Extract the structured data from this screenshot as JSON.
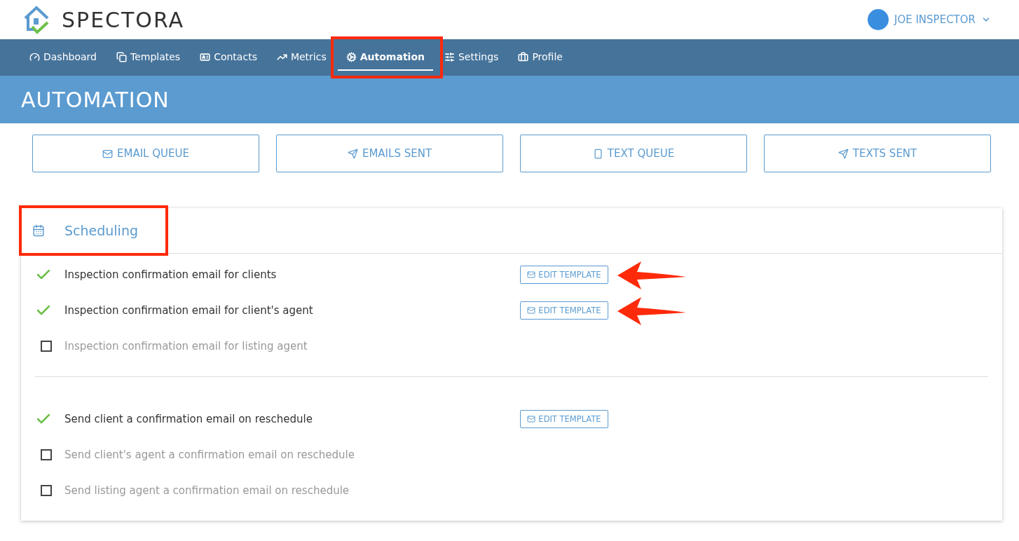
{
  "brand": {
    "name": "SPECTORA"
  },
  "user": {
    "name": "JOE INSPECTOR"
  },
  "nav": [
    {
      "label": "Dashboard",
      "selected": false,
      "highlighted": false
    },
    {
      "label": "Templates",
      "selected": false,
      "highlighted": false
    },
    {
      "label": "Contacts",
      "selected": false,
      "highlighted": false
    },
    {
      "label": "Metrics",
      "selected": false,
      "highlighted": false
    },
    {
      "label": "Automation",
      "selected": true,
      "highlighted": true
    },
    {
      "label": "Settings",
      "selected": false,
      "highlighted": false
    },
    {
      "label": "Profile",
      "selected": false,
      "highlighted": false
    }
  ],
  "page_title": "AUTOMATION",
  "actions": [
    {
      "label": "EMAIL QUEUE",
      "kind": "envelope"
    },
    {
      "label": "EMAILS SENT",
      "kind": "plane"
    },
    {
      "label": "TEXT QUEUE",
      "kind": "phone"
    },
    {
      "label": "TEXTS SENT",
      "kind": "plane"
    }
  ],
  "section": {
    "title": "Scheduling",
    "highlighted": true,
    "groups": [
      [
        {
          "label": "Inspection confirmation email for clients",
          "checked": true,
          "button": "EDIT TEMPLATE",
          "arrow": true
        },
        {
          "label": "Inspection confirmation email for client's agent",
          "checked": true,
          "button": "EDIT TEMPLATE",
          "arrow": true
        },
        {
          "label": "Inspection confirmation email for listing agent",
          "checked": false
        }
      ],
      [
        {
          "label": "Send client a confirmation email on reschedule",
          "checked": true,
          "button": "EDIT TEMPLATE"
        },
        {
          "label": "Send client's agent a confirmation email on reschedule",
          "checked": false
        },
        {
          "label": "Send listing agent a confirmation email on reschedule",
          "checked": false
        }
      ]
    ]
  }
}
